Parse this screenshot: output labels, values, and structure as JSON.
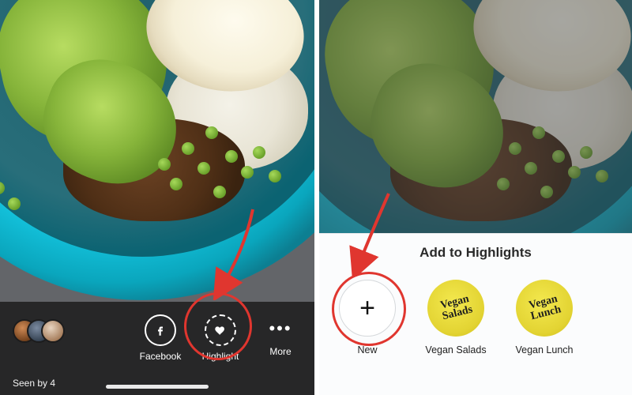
{
  "left_panel": {
    "viewers": {
      "count_label": "Seen by 4"
    },
    "actions": {
      "facebook": {
        "label": "Facebook"
      },
      "highlight": {
        "label": "Highlight"
      },
      "more": {
        "label": "More"
      }
    }
  },
  "right_panel": {
    "sheet_title": "Add to Highlights",
    "items": {
      "new": {
        "label": "New",
        "glyph": "+"
      },
      "vs": {
        "label": "Vegan Salads",
        "cover_line1": "Vegan",
        "cover_line2": "Salads"
      },
      "vl": {
        "label": "Vegan Lunch",
        "cover_line1": "Vegan",
        "cover_line2": "Lunch"
      }
    }
  },
  "colors": {
    "accent_red": "#e0362f"
  }
}
